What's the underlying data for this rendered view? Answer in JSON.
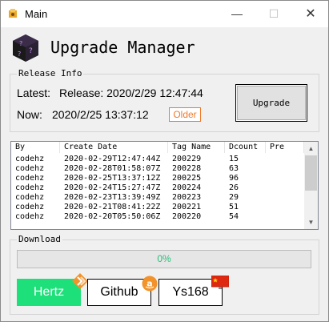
{
  "window": {
    "title": "Main",
    "controls": {
      "minimize": "—",
      "maximize": "☐",
      "close": "✕"
    }
  },
  "header": {
    "title": "Upgrade Manager",
    "logo_icon": "cube-icon"
  },
  "release_info": {
    "legend": "Release Info",
    "latest_label": "Latest:",
    "latest_value": "Release:  2020/2/29 12:47:44",
    "now_label": "Now:",
    "now_value": "2020/2/25 13:37:12",
    "status_badge": "Older",
    "upgrade_button": "Upgrade"
  },
  "table": {
    "columns": [
      "By",
      "Create Date",
      "Tag Name",
      "Dcount",
      "Pre"
    ],
    "rows": [
      [
        "codehz",
        "2020-02-29T12:47:44Z",
        "200229",
        "15",
        ""
      ],
      [
        "codehz",
        "2020-02-28T01:58:07Z",
        "200228",
        "63",
        ""
      ],
      [
        "codehz",
        "2020-02-25T13:37:12Z",
        "200225",
        "96",
        ""
      ],
      [
        "codehz",
        "2020-02-24T15:27:47Z",
        "200224",
        "26",
        ""
      ],
      [
        "codehz",
        "2020-02-23T13:39:49Z",
        "200223",
        "29",
        ""
      ],
      [
        "codehz",
        "2020-02-21T08:41:22Z",
        "200221",
        "51",
        ""
      ],
      [
        "codehz",
        "2020-02-20T05:50:06Z",
        "200220",
        "54",
        ""
      ]
    ]
  },
  "download": {
    "legend": "Download",
    "progress": 0,
    "progress_text": "0%"
  },
  "links": [
    {
      "label": "Hertz",
      "icon": "hertz-diamond-icon"
    },
    {
      "label": "Github",
      "icon": "amazon-a-icon"
    },
    {
      "label": "Ys168",
      "icon": "china-flag-icon"
    }
  ],
  "colors": {
    "accent_green": "#1ee07a",
    "older_orange": "#f07a2b",
    "progress_text": "#27c07a"
  }
}
